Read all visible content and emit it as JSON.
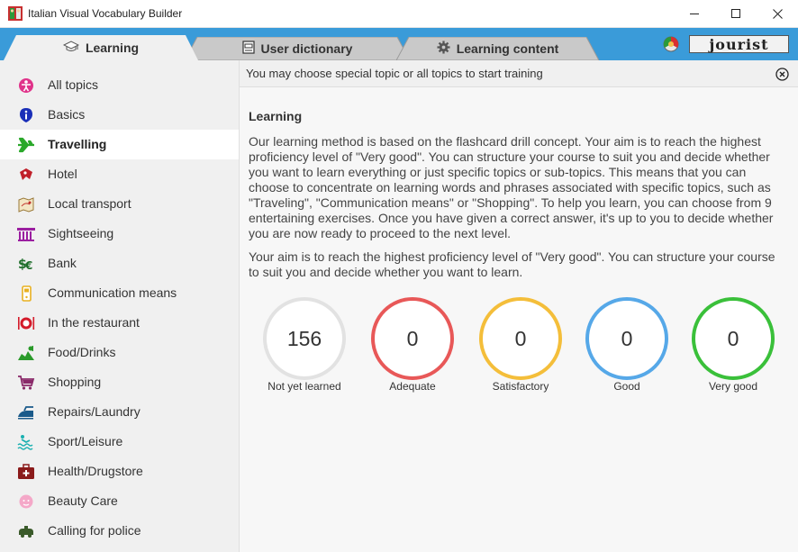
{
  "window": {
    "title": "Italian Visual Vocabulary Builder"
  },
  "tabs": [
    {
      "label": "Learning",
      "icon": "graduation-cap-icon",
      "active": true
    },
    {
      "label": "User dictionary",
      "icon": "dictionary-icon",
      "active": false
    },
    {
      "label": "Learning content",
      "icon": "gear-icon",
      "active": false
    }
  ],
  "brand": {
    "logo_text": "jourist"
  },
  "sidebar": {
    "items": [
      {
        "label": "All topics",
        "icon": "all-topics-icon",
        "color": "#e0338a"
      },
      {
        "label": "Basics",
        "icon": "info-icon",
        "color": "#1a2fb8"
      },
      {
        "label": "Travelling",
        "icon": "airplane-icon",
        "color": "#2aa82a",
        "active": true
      },
      {
        "label": "Hotel",
        "icon": "hotel-icon",
        "color": "#c0202a"
      },
      {
        "label": "Local transport",
        "icon": "map-icon",
        "color": "#9a7a3a"
      },
      {
        "label": "Sightseeing",
        "icon": "columns-icon",
        "color": "#9b1fa0"
      },
      {
        "label": "Bank",
        "icon": "currency-icon",
        "color": "#1e6e2a"
      },
      {
        "label": "Communication means",
        "icon": "phone-icon",
        "color": "#e8b020"
      },
      {
        "label": "In the restaurant",
        "icon": "plate-icon",
        "color": "#d41b2a"
      },
      {
        "label": "Food/Drinks",
        "icon": "food-icon",
        "color": "#2a9a2a"
      },
      {
        "label": "Shopping",
        "icon": "cart-icon",
        "color": "#8a2a6a"
      },
      {
        "label": "Repairs/Laundry",
        "icon": "iron-icon",
        "color": "#1a5a8a"
      },
      {
        "label": "Sport/Leisure",
        "icon": "swimming-icon",
        "color": "#1ab0b0"
      },
      {
        "label": "Health/Drugstore",
        "icon": "first-aid-icon",
        "color": "#8a1a1a"
      },
      {
        "label": "Beauty Care",
        "icon": "face-icon",
        "color": "#e070a0"
      },
      {
        "label": "Calling for police",
        "icon": "police-icon",
        "color": "#3a5a2a"
      }
    ]
  },
  "notice": {
    "text": "You may choose special topic or all topics to start training"
  },
  "content": {
    "title": "Learning",
    "paragraph1": "Our learning method is based on the flashcard drill concept. Your aim is to reach the highest proficiency level of \"Very good\". You can structure your course to suit you and decide whether you want to learn everything or just specific topics or sub-topics. This means that you can choose to concentrate on learning words and phrases associated with specific topics, such as \"Traveling\", \"Communication means\" or \"Shopping\". To help you learn, you can choose from 9 entertaining exercises. Once you have given a correct answer, it's up to you to decide whether you are now ready to proceed to the next level.",
    "paragraph2": "Your aim is to reach the highest proficiency level of \"Very good\". You can structure your course to suit you and decide whether you want to learn."
  },
  "stats": [
    {
      "label": "Not yet learned",
      "value": "156",
      "color": "#e2e2e2"
    },
    {
      "label": "Adequate",
      "value": "0",
      "color": "#e85858"
    },
    {
      "label": "Satisfactory",
      "value": "0",
      "color": "#f4be3a"
    },
    {
      "label": "Good",
      "value": "0",
      "color": "#56a8e8"
    },
    {
      "label": "Very good",
      "value": "0",
      "color": "#3ac03a"
    }
  ],
  "colors": {
    "tabbar": "#3a9bd9",
    "sidebar_bg": "#f0f0f0",
    "main_bg": "#f7f7f7"
  }
}
